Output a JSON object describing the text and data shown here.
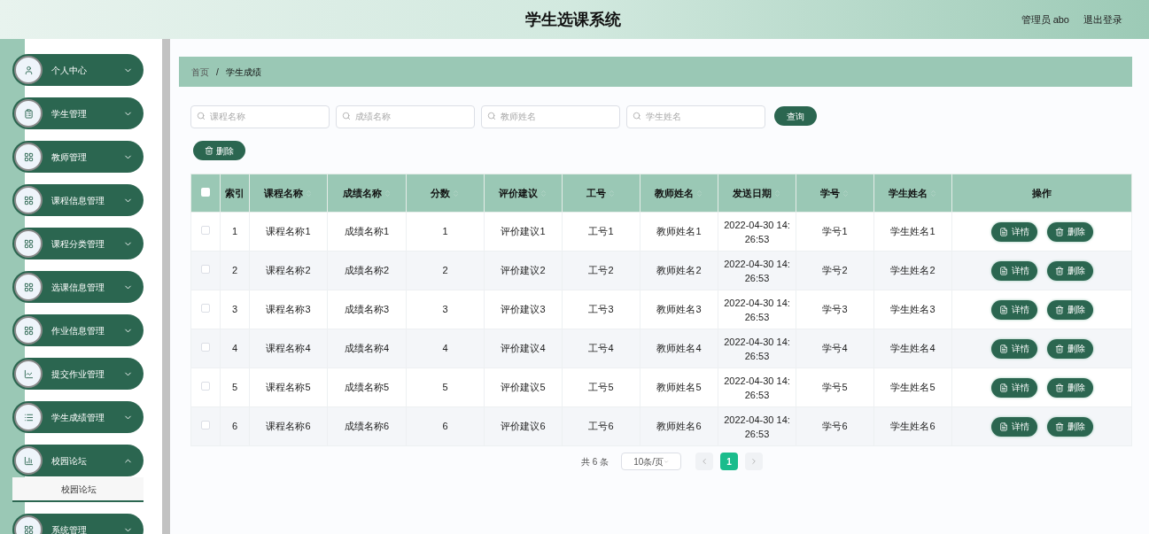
{
  "header": {
    "title": "学生选课系统",
    "user": "管理员 abo",
    "logout": "退出登录"
  },
  "sidebar": {
    "items": [
      {
        "label": "个人中心",
        "expanded": false
      },
      {
        "label": "学生管理",
        "expanded": false
      },
      {
        "label": "教师管理",
        "expanded": false
      },
      {
        "label": "课程信息管理",
        "expanded": false
      },
      {
        "label": "课程分类管理",
        "expanded": false
      },
      {
        "label": "选课信息管理",
        "expanded": false
      },
      {
        "label": "作业信息管理",
        "expanded": false
      },
      {
        "label": "提交作业管理",
        "expanded": false
      },
      {
        "label": "学生成绩管理",
        "expanded": false
      },
      {
        "label": "校园论坛",
        "expanded": true,
        "children": [
          {
            "label": "校园论坛"
          }
        ]
      },
      {
        "label": "系统管理",
        "expanded": false
      }
    ]
  },
  "breadcrumb": {
    "items": [
      "首页",
      "学生成绩"
    ],
    "separator": "/"
  },
  "search": {
    "fields": [
      {
        "placeholder": "课程名称"
      },
      {
        "placeholder": "成绩名称"
      },
      {
        "placeholder": "教师姓名"
      },
      {
        "placeholder": "学生姓名"
      }
    ],
    "button": "查询"
  },
  "delete_button": "删除",
  "table": {
    "select_all_checked": false,
    "columns": [
      {
        "label": "索引",
        "sortable": false
      },
      {
        "label": "课程名称",
        "sortable": true
      },
      {
        "label": "成绩名称",
        "sortable": true
      },
      {
        "label": "分数",
        "sortable": true
      },
      {
        "label": "评价建议",
        "sortable": true
      },
      {
        "label": "工号",
        "sortable": true
      },
      {
        "label": "教师姓名",
        "sortable": true
      },
      {
        "label": "发送日期",
        "sortable": true
      },
      {
        "label": "学号",
        "sortable": true
      },
      {
        "label": "学生姓名",
        "sortable": true
      },
      {
        "label": "操作",
        "sortable": false
      }
    ],
    "rows": [
      {
        "checked": false,
        "cells": [
          "1",
          "课程名称1",
          "成绩名称1",
          "1",
          "评价建议1",
          "工号1",
          "教师姓名1",
          "2022-04-30 14:26:53",
          "学号1",
          "学生姓名1"
        ],
        "actions": [
          "详情",
          "删除"
        ]
      },
      {
        "checked": false,
        "cells": [
          "2",
          "课程名称2",
          "成绩名称2",
          "2",
          "评价建议2",
          "工号2",
          "教师姓名2",
          "2022-04-30 14:26:53",
          "学号2",
          "学生姓名2"
        ],
        "actions": [
          "详情",
          "删除"
        ]
      },
      {
        "checked": false,
        "cells": [
          "3",
          "课程名称3",
          "成绩名称3",
          "3",
          "评价建议3",
          "工号3",
          "教师姓名3",
          "2022-04-30 14:26:53",
          "学号3",
          "学生姓名3"
        ],
        "actions": [
          "详情",
          "删除"
        ]
      },
      {
        "checked": false,
        "cells": [
          "4",
          "课程名称4",
          "成绩名称4",
          "4",
          "评价建议4",
          "工号4",
          "教师姓名4",
          "2022-04-30 14:26:53",
          "学号4",
          "学生姓名4"
        ],
        "actions": [
          "详情",
          "删除"
        ]
      },
      {
        "checked": false,
        "cells": [
          "5",
          "课程名称5",
          "成绩名称5",
          "5",
          "评价建议5",
          "工号5",
          "教师姓名5",
          "2022-04-30 14:26:53",
          "学号5",
          "学生姓名5"
        ],
        "actions": [
          "详情",
          "删除"
        ]
      },
      {
        "checked": false,
        "cells": [
          "6",
          "课程名称6",
          "成绩名称6",
          "6",
          "评价建议6",
          "工号6",
          "教师姓名6",
          "2022-04-30 14:26:53",
          "学号6",
          "学生姓名6"
        ],
        "actions": [
          "详情",
          "删除"
        ]
      }
    ]
  },
  "pagination": {
    "total": "共 6 条",
    "page_size": "10条/页",
    "pages": [
      {
        "label": "1",
        "selected": true
      }
    ]
  }
}
